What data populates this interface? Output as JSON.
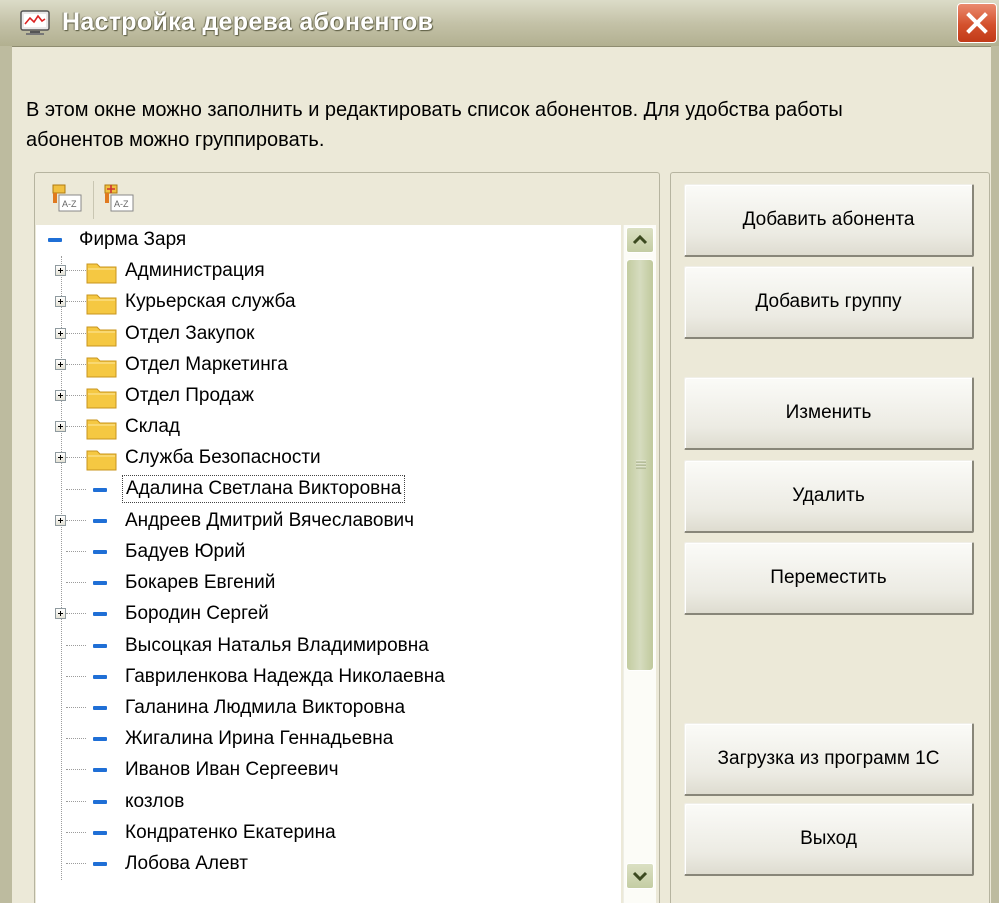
{
  "window": {
    "title": "Настройка дерева абонентов",
    "description": "В этом окне можно заполнить и редактировать список абонентов. Для удобства работы\nабонентов можно группировать."
  },
  "toolbar": {
    "icons": [
      "sort-az-ascending-icon",
      "sort-az-descending-icon"
    ]
  },
  "tree": {
    "root": "Фирма Заря",
    "groups": [
      "Администрация",
      "Курьерская служба",
      "Отдел Закупок",
      "Отдел Маркетинга",
      "Отдел Продаж",
      "Склад",
      "Служба Безопасности"
    ],
    "people": [
      {
        "name": "Адалина Светлана Викторовна",
        "selected": true,
        "expandable": false
      },
      {
        "name": "Андреев Дмитрий Вячеславович",
        "expandable": true
      },
      {
        "name": "Бадуев Юрий",
        "expandable": false
      },
      {
        "name": "Бокарев Евгений",
        "expandable": false
      },
      {
        "name": "Бородин Сергей",
        "expandable": true
      },
      {
        "name": "Высоцкая Наталья Владимировна",
        "expandable": false
      },
      {
        "name": "Гавриленкова Надежда Николаевна",
        "expandable": false
      },
      {
        "name": "Галанина Людмила Викторовна",
        "expandable": false
      },
      {
        "name": "Жигалина Ирина Геннадьевна",
        "expandable": false
      },
      {
        "name": "Иванов Иван Сергеевич",
        "expandable": false
      },
      {
        "name": "козлов",
        "expandable": false
      },
      {
        "name": "Кондратенко Екатерина",
        "expandable": false
      },
      {
        "name": "Лобова Алевт",
        "expandable": false
      }
    ]
  },
  "buttons": {
    "add_subscriber": "Добавить абонента",
    "add_group": "Добавить группу",
    "edit": "Изменить",
    "delete": "Удалить",
    "move": "Переместить",
    "import_1c": "Загрузка из программ 1С",
    "exit": "Выход"
  },
  "colors": {
    "window_face": "#ece9d8",
    "tree_leaf_dash": "#1f6fd6",
    "folder": "#f5c842",
    "close_button": "#d4512d"
  }
}
